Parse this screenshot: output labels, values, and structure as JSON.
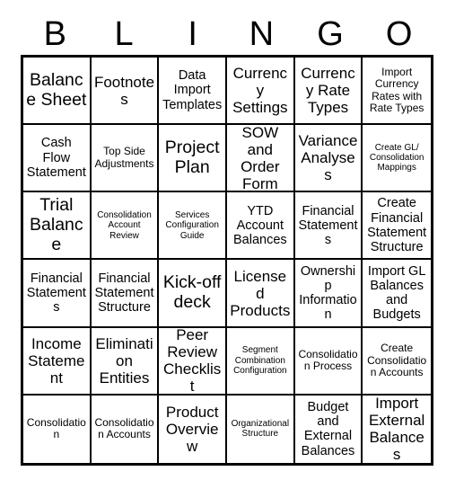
{
  "header": {
    "letters": [
      "B",
      "L",
      "I",
      "N",
      "G",
      "O"
    ]
  },
  "colors": {
    "border": "#000000",
    "cell_background": "#ffffff",
    "text": "#000000",
    "page_background": "#ffffff"
  },
  "grid": {
    "columns": 6,
    "rows": 6,
    "cells": [
      [
        {
          "label": "Balance Sheet",
          "size": "xl"
        },
        {
          "label": "Footnotes",
          "size": "lg"
        },
        {
          "label": "Data Import Templates",
          "size": "md"
        },
        {
          "label": "Currency Settings",
          "size": "lg"
        },
        {
          "label": "Currency Rate Types",
          "size": "lg"
        },
        {
          "label": "Import Currency Rates with Rate Types",
          "size": "sm"
        }
      ],
      [
        {
          "label": "Cash Flow Statement",
          "size": "md"
        },
        {
          "label": "Top Side Adjustments",
          "size": "sm"
        },
        {
          "label": "Project Plan",
          "size": "xl"
        },
        {
          "label": "SOW and Order Form",
          "size": "lg"
        },
        {
          "label": "Variance Analyses",
          "size": "lg"
        },
        {
          "label": "Create GL/ Consolidation Mappings",
          "size": "xs"
        }
      ],
      [
        {
          "label": "Trial Balance",
          "size": "xl"
        },
        {
          "label": "Consolidation Account Review",
          "size": "xs"
        },
        {
          "label": "Services Configuration Guide",
          "size": "xs"
        },
        {
          "label": "YTD Account Balances",
          "size": "md"
        },
        {
          "label": "Financial Statements",
          "size": "md"
        },
        {
          "label": "Create Financial Statement Structure",
          "size": "md"
        }
      ],
      [
        {
          "label": "Financial Statements",
          "size": "md"
        },
        {
          "label": "Financial Statement Structure",
          "size": "md"
        },
        {
          "label": "Kick-off deck",
          "size": "xl"
        },
        {
          "label": "Licensed Products",
          "size": "lg"
        },
        {
          "label": "Ownership Information",
          "size": "md"
        },
        {
          "label": "Import GL Balances and Budgets",
          "size": "md"
        }
      ],
      [
        {
          "label": "Income Statement",
          "size": "lg"
        },
        {
          "label": "Elimination Entities",
          "size": "lg"
        },
        {
          "label": "Peer Review Checklist",
          "size": "lg"
        },
        {
          "label": "Segment Combination Configuration",
          "size": "xs"
        },
        {
          "label": "Consolidation Process",
          "size": "sm"
        },
        {
          "label": "Create Consolidation Accounts",
          "size": "sm"
        }
      ],
      [
        {
          "label": "Consolidation",
          "size": "sm"
        },
        {
          "label": "Consolidation Accounts",
          "size": "sm"
        },
        {
          "label": "Product Overview",
          "size": "lg"
        },
        {
          "label": "Organizational Structure",
          "size": "xs"
        },
        {
          "label": "Budget and External Balances",
          "size": "md"
        },
        {
          "label": "Import External Balances",
          "size": "lg"
        }
      ]
    ]
  }
}
